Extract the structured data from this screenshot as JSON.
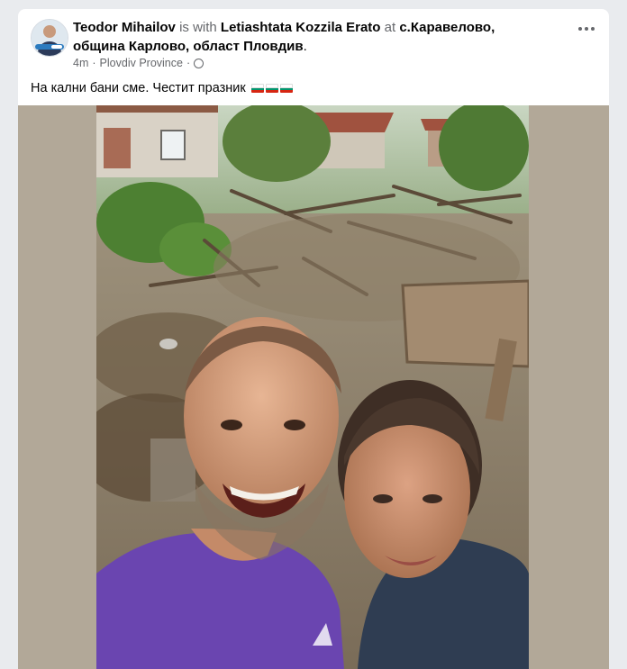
{
  "post": {
    "author": "Teodor Mihailov",
    "with_text": " is with ",
    "tagged": "Letiashtata Kozzila Erato",
    "at_text": " at ",
    "place": "с.Каравелово, община Карлово, област Пловдив",
    "period": ".",
    "time": "4m",
    "separator": "·",
    "location": "Plovdiv Province",
    "separator2": "·",
    "text": "На кални бани сме. Честит празник",
    "flag_colors": [
      "#ffffff",
      "#00966e",
      "#d62612"
    ]
  },
  "icons": {
    "privacy": "globe-icon",
    "more": "more-options-icon",
    "avatar": "profile-avatar"
  }
}
